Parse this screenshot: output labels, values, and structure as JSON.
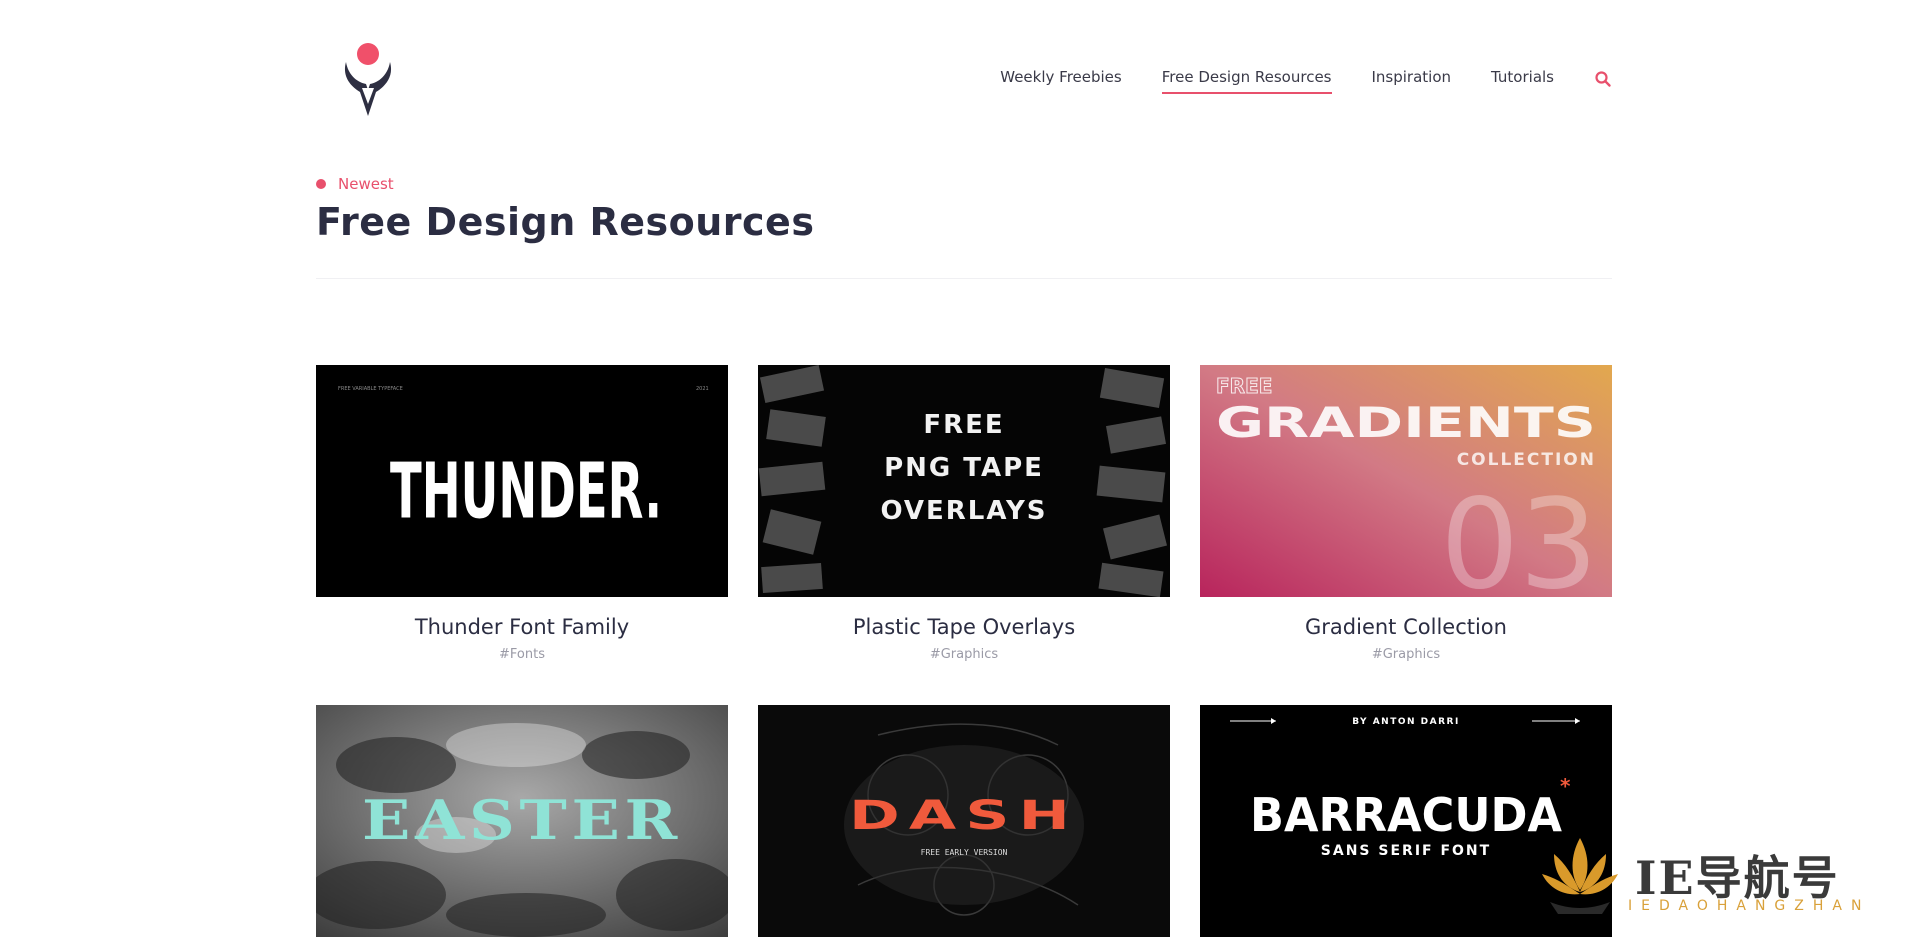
{
  "header": {
    "nav": [
      {
        "label": "Weekly Freebies",
        "active": false
      },
      {
        "label": "Free Design Resources",
        "active": true
      },
      {
        "label": "Inspiration",
        "active": false
      },
      {
        "label": "Tutorials",
        "active": false
      }
    ]
  },
  "section": {
    "eyebrow": "Newest",
    "title": "Free Design Resources"
  },
  "cards": [
    {
      "title": "Thunder Font Family",
      "tag": "#Fonts",
      "thumb": {
        "small_left": "FREE VARIABLE TYPEFACE",
        "small_right": "2021",
        "headline": "THUNDER."
      }
    },
    {
      "title": "Plastic Tape Overlays",
      "tag": "#Graphics",
      "thumb": {
        "line1": "FREE",
        "line2": "PNG TAPE",
        "line3": "OVERLAYS"
      }
    },
    {
      "title": "Gradient Collection",
      "tag": "#Graphics",
      "thumb": {
        "line1": "FREE",
        "line2": "GRADIENTS",
        "line3": "COLLECTION",
        "number": "03"
      }
    },
    {
      "title": "",
      "tag": "",
      "thumb": {
        "headline": "EASTER"
      }
    },
    {
      "title": "",
      "tag": "",
      "thumb": {
        "headline": "DASH",
        "sub": "FREE EARLY VERSION"
      }
    },
    {
      "title": "",
      "tag": "",
      "thumb": {
        "top": "BY ANTON DARRI",
        "headline": "BARRACUDA",
        "sub": "SANS SERIF FONT"
      }
    }
  ],
  "watermark": {
    "text": "IE导航号",
    "sub": "IEDAOHANGZHAN"
  },
  "colors": {
    "accent": "#e8506c",
    "title": "#2b2d42",
    "tag": "#9a9aa6"
  }
}
